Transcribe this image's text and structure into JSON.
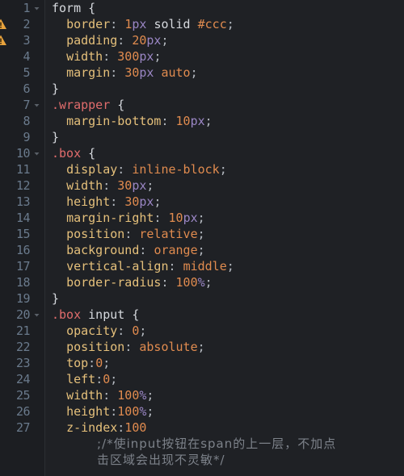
{
  "editor": {
    "language": "css",
    "theme": {
      "background": "#1f2125",
      "gutter_background": "#1c1e22",
      "line_number_color": "#6a7a8c",
      "element_selector_color": "#d6d9de",
      "class_selector_color": "#e06c6c",
      "property_color": "#e5c07b",
      "number_color": "#e08b4f",
      "unit_color": "#9a86c4",
      "keyword_color": "#e08b4f",
      "comment_color": "#7d828a",
      "warning_icon_color": "#e8a33d"
    },
    "lines": [
      {
        "number": "1",
        "fold": true,
        "warning": false,
        "tokens": [
          {
            "t": "form",
            "c": "tok-element"
          },
          {
            "t": " ",
            "c": "tok-plain"
          },
          {
            "t": "{",
            "c": "tok-brace"
          }
        ]
      },
      {
        "number": "2",
        "fold": false,
        "warning": true,
        "tokens": [
          {
            "t": "  ",
            "c": "tok-plain"
          },
          {
            "t": "border",
            "c": "tok-prop"
          },
          {
            "t": ": ",
            "c": "tok-punct"
          },
          {
            "t": "1",
            "c": "tok-num"
          },
          {
            "t": "px",
            "c": "tok-unit"
          },
          {
            "t": " ",
            "c": "tok-plain"
          },
          {
            "t": "solid",
            "c": "tok-plain"
          },
          {
            "t": " ",
            "c": "tok-plain"
          },
          {
            "t": "#ccc",
            "c": "tok-num"
          },
          {
            "t": ";",
            "c": "tok-punct"
          }
        ]
      },
      {
        "number": "3",
        "fold": false,
        "warning": true,
        "tokens": [
          {
            "t": "  ",
            "c": "tok-plain"
          },
          {
            "t": "padding",
            "c": "tok-prop"
          },
          {
            "t": ": ",
            "c": "tok-punct"
          },
          {
            "t": "20",
            "c": "tok-num"
          },
          {
            "t": "px",
            "c": "tok-unit"
          },
          {
            "t": ";",
            "c": "tok-punct"
          }
        ]
      },
      {
        "number": "4",
        "fold": false,
        "warning": false,
        "tokens": [
          {
            "t": "  ",
            "c": "tok-plain"
          },
          {
            "t": "width",
            "c": "tok-prop"
          },
          {
            "t": ": ",
            "c": "tok-punct"
          },
          {
            "t": "300",
            "c": "tok-num"
          },
          {
            "t": "px",
            "c": "tok-unit"
          },
          {
            "t": ";",
            "c": "tok-punct"
          }
        ]
      },
      {
        "number": "5",
        "fold": false,
        "warning": false,
        "tokens": [
          {
            "t": "  ",
            "c": "tok-plain"
          },
          {
            "t": "margin",
            "c": "tok-prop"
          },
          {
            "t": ": ",
            "c": "tok-punct"
          },
          {
            "t": "30",
            "c": "tok-num"
          },
          {
            "t": "px",
            "c": "tok-unit"
          },
          {
            "t": " ",
            "c": "tok-plain"
          },
          {
            "t": "auto",
            "c": "tok-keyword"
          },
          {
            "t": ";",
            "c": "tok-punct"
          }
        ]
      },
      {
        "number": "6",
        "fold": false,
        "warning": false,
        "tokens": [
          {
            "t": "}",
            "c": "tok-brace"
          }
        ]
      },
      {
        "number": "7",
        "fold": true,
        "warning": false,
        "tokens": [
          {
            "t": ".wrapper",
            "c": "tok-class"
          },
          {
            "t": " ",
            "c": "tok-plain"
          },
          {
            "t": "{",
            "c": "tok-brace"
          }
        ]
      },
      {
        "number": "8",
        "fold": false,
        "warning": false,
        "tokens": [
          {
            "t": "  ",
            "c": "tok-plain"
          },
          {
            "t": "margin-bottom",
            "c": "tok-prop"
          },
          {
            "t": ": ",
            "c": "tok-punct"
          },
          {
            "t": "10",
            "c": "tok-num"
          },
          {
            "t": "px",
            "c": "tok-unit"
          },
          {
            "t": ";",
            "c": "tok-punct"
          }
        ]
      },
      {
        "number": "9",
        "fold": false,
        "warning": false,
        "tokens": [
          {
            "t": "}",
            "c": "tok-brace"
          }
        ]
      },
      {
        "number": "10",
        "fold": true,
        "warning": false,
        "tokens": [
          {
            "t": ".box",
            "c": "tok-class"
          },
          {
            "t": " ",
            "c": "tok-plain"
          },
          {
            "t": "{",
            "c": "tok-brace"
          }
        ]
      },
      {
        "number": "11",
        "fold": false,
        "warning": false,
        "tokens": [
          {
            "t": "  ",
            "c": "tok-plain"
          },
          {
            "t": "display",
            "c": "tok-prop"
          },
          {
            "t": ": ",
            "c": "tok-punct"
          },
          {
            "t": "inline-block",
            "c": "tok-keyword"
          },
          {
            "t": ";",
            "c": "tok-punct"
          }
        ]
      },
      {
        "number": "12",
        "fold": false,
        "warning": false,
        "tokens": [
          {
            "t": "  ",
            "c": "tok-plain"
          },
          {
            "t": "width",
            "c": "tok-prop"
          },
          {
            "t": ": ",
            "c": "tok-punct"
          },
          {
            "t": "30",
            "c": "tok-num"
          },
          {
            "t": "px",
            "c": "tok-unit"
          },
          {
            "t": ";",
            "c": "tok-punct"
          }
        ]
      },
      {
        "number": "13",
        "fold": false,
        "warning": false,
        "tokens": [
          {
            "t": "  ",
            "c": "tok-plain"
          },
          {
            "t": "height",
            "c": "tok-prop"
          },
          {
            "t": ": ",
            "c": "tok-punct"
          },
          {
            "t": "30",
            "c": "tok-num"
          },
          {
            "t": "px",
            "c": "tok-unit"
          },
          {
            "t": ";",
            "c": "tok-punct"
          }
        ]
      },
      {
        "number": "14",
        "fold": false,
        "warning": false,
        "tokens": [
          {
            "t": "  ",
            "c": "tok-plain"
          },
          {
            "t": "margin-right",
            "c": "tok-prop"
          },
          {
            "t": ": ",
            "c": "tok-punct"
          },
          {
            "t": "10",
            "c": "tok-num"
          },
          {
            "t": "px",
            "c": "tok-unit"
          },
          {
            "t": ";",
            "c": "tok-punct"
          }
        ]
      },
      {
        "number": "15",
        "fold": false,
        "warning": false,
        "tokens": [
          {
            "t": "  ",
            "c": "tok-plain"
          },
          {
            "t": "position",
            "c": "tok-prop"
          },
          {
            "t": ": ",
            "c": "tok-punct"
          },
          {
            "t": "relative",
            "c": "tok-keyword"
          },
          {
            "t": ";",
            "c": "tok-punct"
          }
        ]
      },
      {
        "number": "16",
        "fold": false,
        "warning": false,
        "tokens": [
          {
            "t": "  ",
            "c": "tok-plain"
          },
          {
            "t": "background",
            "c": "tok-prop"
          },
          {
            "t": ": ",
            "c": "tok-punct"
          },
          {
            "t": "orange",
            "c": "tok-keyword"
          },
          {
            "t": ";",
            "c": "tok-punct"
          }
        ]
      },
      {
        "number": "17",
        "fold": false,
        "warning": false,
        "tokens": [
          {
            "t": "  ",
            "c": "tok-plain"
          },
          {
            "t": "vertical-align",
            "c": "tok-prop"
          },
          {
            "t": ": ",
            "c": "tok-punct"
          },
          {
            "t": "middle",
            "c": "tok-keyword"
          },
          {
            "t": ";",
            "c": "tok-punct"
          }
        ]
      },
      {
        "number": "18",
        "fold": false,
        "warning": false,
        "tokens": [
          {
            "t": "  ",
            "c": "tok-plain"
          },
          {
            "t": "border-radius",
            "c": "tok-prop"
          },
          {
            "t": ": ",
            "c": "tok-punct"
          },
          {
            "t": "100",
            "c": "tok-num"
          },
          {
            "t": "%",
            "c": "tok-unit"
          },
          {
            "t": ";",
            "c": "tok-punct"
          }
        ]
      },
      {
        "number": "19",
        "fold": false,
        "warning": false,
        "tokens": [
          {
            "t": "}",
            "c": "tok-brace"
          }
        ]
      },
      {
        "number": "20",
        "fold": true,
        "warning": false,
        "tokens": [
          {
            "t": ".box",
            "c": "tok-class"
          },
          {
            "t": " ",
            "c": "tok-plain"
          },
          {
            "t": "input",
            "c": "tok-element"
          },
          {
            "t": " ",
            "c": "tok-plain"
          },
          {
            "t": "{",
            "c": "tok-brace"
          }
        ]
      },
      {
        "number": "21",
        "fold": false,
        "warning": false,
        "tokens": [
          {
            "t": "  ",
            "c": "tok-plain"
          },
          {
            "t": "opacity",
            "c": "tok-prop"
          },
          {
            "t": ": ",
            "c": "tok-punct"
          },
          {
            "t": "0",
            "c": "tok-num"
          },
          {
            "t": ";",
            "c": "tok-punct"
          }
        ]
      },
      {
        "number": "22",
        "fold": false,
        "warning": false,
        "tokens": [
          {
            "t": "  ",
            "c": "tok-plain"
          },
          {
            "t": "position",
            "c": "tok-prop"
          },
          {
            "t": ": ",
            "c": "tok-punct"
          },
          {
            "t": "absolute",
            "c": "tok-keyword"
          },
          {
            "t": ";",
            "c": "tok-punct"
          }
        ]
      },
      {
        "number": "23",
        "fold": false,
        "warning": false,
        "tokens": [
          {
            "t": "  ",
            "c": "tok-plain"
          },
          {
            "t": "top",
            "c": "tok-prop"
          },
          {
            "t": ":",
            "c": "tok-punct"
          },
          {
            "t": "0",
            "c": "tok-num"
          },
          {
            "t": ";",
            "c": "tok-punct"
          }
        ]
      },
      {
        "number": "24",
        "fold": false,
        "warning": false,
        "tokens": [
          {
            "t": "  ",
            "c": "tok-plain"
          },
          {
            "t": "left",
            "c": "tok-prop"
          },
          {
            "t": ":",
            "c": "tok-punct"
          },
          {
            "t": "0",
            "c": "tok-num"
          },
          {
            "t": ";",
            "c": "tok-punct"
          }
        ]
      },
      {
        "number": "25",
        "fold": false,
        "warning": false,
        "tokens": [
          {
            "t": "  ",
            "c": "tok-plain"
          },
          {
            "t": "width",
            "c": "tok-prop"
          },
          {
            "t": ": ",
            "c": "tok-punct"
          },
          {
            "t": "100",
            "c": "tok-num"
          },
          {
            "t": "%",
            "c": "tok-unit"
          },
          {
            "t": ";",
            "c": "tok-punct"
          }
        ]
      },
      {
        "number": "26",
        "fold": false,
        "warning": false,
        "tokens": [
          {
            "t": "  ",
            "c": "tok-plain"
          },
          {
            "t": "height",
            "c": "tok-prop"
          },
          {
            "t": ":",
            "c": "tok-punct"
          },
          {
            "t": "100",
            "c": "tok-num"
          },
          {
            "t": "%",
            "c": "tok-unit"
          },
          {
            "t": ";",
            "c": "tok-punct"
          }
        ]
      },
      {
        "number": "27",
        "fold": false,
        "warning": false,
        "tokens": [
          {
            "t": "  ",
            "c": "tok-plain"
          },
          {
            "t": "z-index",
            "c": "tok-prop"
          },
          {
            "t": ":",
            "c": "tok-punct"
          },
          {
            "t": "100",
            "c": "tok-num"
          }
        ]
      }
    ],
    "comment_wrap": {
      "line_1": ";/*使input按钮在span的上一层，不加点",
      "line_2": "击区域会出现不灵敏*/"
    }
  }
}
